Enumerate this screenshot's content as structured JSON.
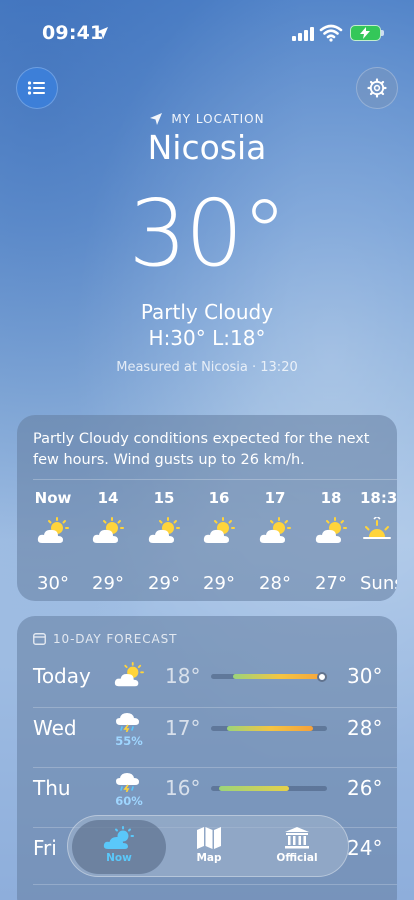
{
  "status_bar": {
    "time": "09:41"
  },
  "location": {
    "label": "MY LOCATION",
    "city": "Nicosia"
  },
  "current": {
    "temperature": "30°",
    "condition": "Partly Cloudy",
    "hilo": "H:30°  L:18°",
    "measured": "Measured at Nicosia · 13:20"
  },
  "hourly": {
    "summary": "Partly Cloudy conditions expected for the next few hours. Wind gusts up to 26 km/h.",
    "hours": [
      {
        "label": "Now",
        "icon": "partly-cloudy-icon",
        "temp": "30°"
      },
      {
        "label": "14",
        "icon": "partly-cloudy-icon",
        "temp": "29°"
      },
      {
        "label": "15",
        "icon": "partly-cloudy-icon",
        "temp": "29°"
      },
      {
        "label": "16",
        "icon": "partly-cloudy-icon",
        "temp": "29°"
      },
      {
        "label": "17",
        "icon": "partly-cloudy-icon",
        "temp": "28°"
      },
      {
        "label": "18",
        "icon": "partly-cloudy-icon",
        "temp": "27°"
      },
      {
        "label": "18:3",
        "icon": "sunset-icon",
        "temp": "Suns"
      }
    ]
  },
  "daily": {
    "title": "10-DAY FORECAST",
    "days": [
      {
        "name": "Today",
        "icon": "partly-cloudy-icon",
        "precip": "",
        "low": "18°",
        "high": "30°"
      },
      {
        "name": "Wed",
        "icon": "thunderstorm-icon",
        "precip": "55%",
        "low": "17°",
        "high": "28°"
      },
      {
        "name": "Thu",
        "icon": "thunderstorm-icon",
        "precip": "60%",
        "low": "16°",
        "high": "26°"
      },
      {
        "name": "Fri",
        "icon": "partly-cloudy-icon",
        "precip": "",
        "low": "",
        "high": "24°"
      }
    ]
  },
  "tabs": [
    {
      "label": "Now",
      "icon": "weather-now-icon",
      "active": true
    },
    {
      "label": "Map",
      "icon": "map-icon",
      "active": false
    },
    {
      "label": "Official",
      "icon": "official-building-icon",
      "active": false
    }
  ],
  "colors": {
    "active_tab": "#5ac8fa",
    "precip": "#9fd6ff",
    "battery": "#34c759"
  }
}
